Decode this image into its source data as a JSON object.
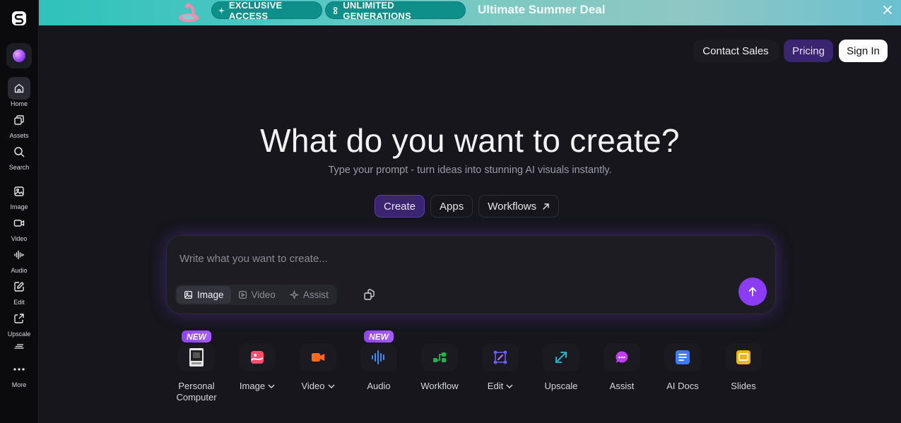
{
  "sidebar": {
    "items": [
      {
        "label": "Home"
      },
      {
        "label": "Assets"
      },
      {
        "label": "Search"
      },
      {
        "label": "Image"
      },
      {
        "label": "Video"
      },
      {
        "label": "Audio"
      },
      {
        "label": "Edit"
      },
      {
        "label": "Upscale"
      },
      {
        "label": "More"
      }
    ]
  },
  "banner": {
    "pill1": "EXCLUSIVE ACCESS",
    "pill2": "UNLIMITED GENERATIONS",
    "deal": "Ultimate Summer Deal"
  },
  "header": {
    "contact": "Contact Sales",
    "pricing": "Pricing",
    "signin": "Sign In"
  },
  "hero": {
    "title": "What do you want to create?",
    "subtitle": "Type your prompt - turn ideas into stunning AI visuals instantly."
  },
  "tabs": [
    {
      "label": "Create"
    },
    {
      "label": "Apps"
    },
    {
      "label": "Workflows"
    }
  ],
  "prompt": {
    "placeholder": "Write what you want to create...",
    "modes": [
      {
        "label": "Image"
      },
      {
        "label": "Video"
      },
      {
        "label": "Assist"
      }
    ]
  },
  "tools": [
    {
      "label": "Personal Computer",
      "badge": "NEW"
    },
    {
      "label": "Image"
    },
    {
      "label": "Video"
    },
    {
      "label": "Audio",
      "badge": "NEW"
    },
    {
      "label": "Workflow"
    },
    {
      "label": "Edit"
    },
    {
      "label": "Upscale"
    },
    {
      "label": "Assist"
    },
    {
      "label": "AI Docs"
    },
    {
      "label": "Slides"
    }
  ],
  "colors": {
    "accent": "#8d3cf5",
    "pricing_bg": "#3a2670",
    "banner_pill": "#0f8f8a"
  }
}
